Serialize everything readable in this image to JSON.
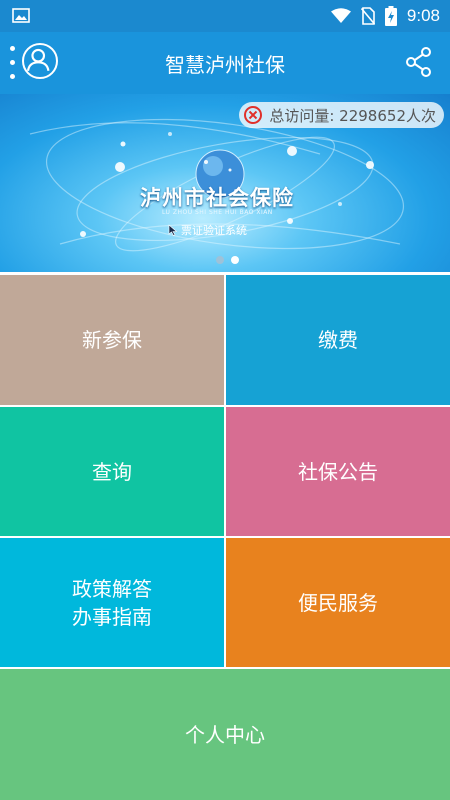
{
  "status_bar": {
    "time": "9:08",
    "icons": [
      "image-icon",
      "wifi-icon",
      "no-sim-icon",
      "battery-charging-icon"
    ]
  },
  "header": {
    "title": "智慧泸州社保",
    "icons": [
      "menu-dots-icon",
      "user-avatar-icon",
      "share-icon"
    ]
  },
  "banner": {
    "visit_counter": "总访问量: 2298652人次",
    "title": "泸州市社会保险",
    "pinyin": "LU ZHOU SHI SHE HUI BAO XIAN",
    "subtitle": "票证验证系统",
    "page_count": 2,
    "active_page": 2
  },
  "tiles": [
    {
      "label": "新参保",
      "color": "#c0a898"
    },
    {
      "label": "缴费",
      "color": "#16a2d4"
    },
    {
      "label": "查询",
      "color": "#10c4a2"
    },
    {
      "label": "社保公告",
      "color": "#d76d92"
    },
    {
      "label": "政策解答\n办事指南",
      "color": "#00b8dc"
    },
    {
      "label": "便民服务",
      "color": "#e8821e"
    },
    {
      "label": "个人中心",
      "color": "#67c57f"
    }
  ],
  "colors": {
    "status_bar": "#1b89cf",
    "title_bar": "#1a94dc",
    "dot_inactive": "#9ec2d8",
    "dot_active": "#ffffff"
  }
}
